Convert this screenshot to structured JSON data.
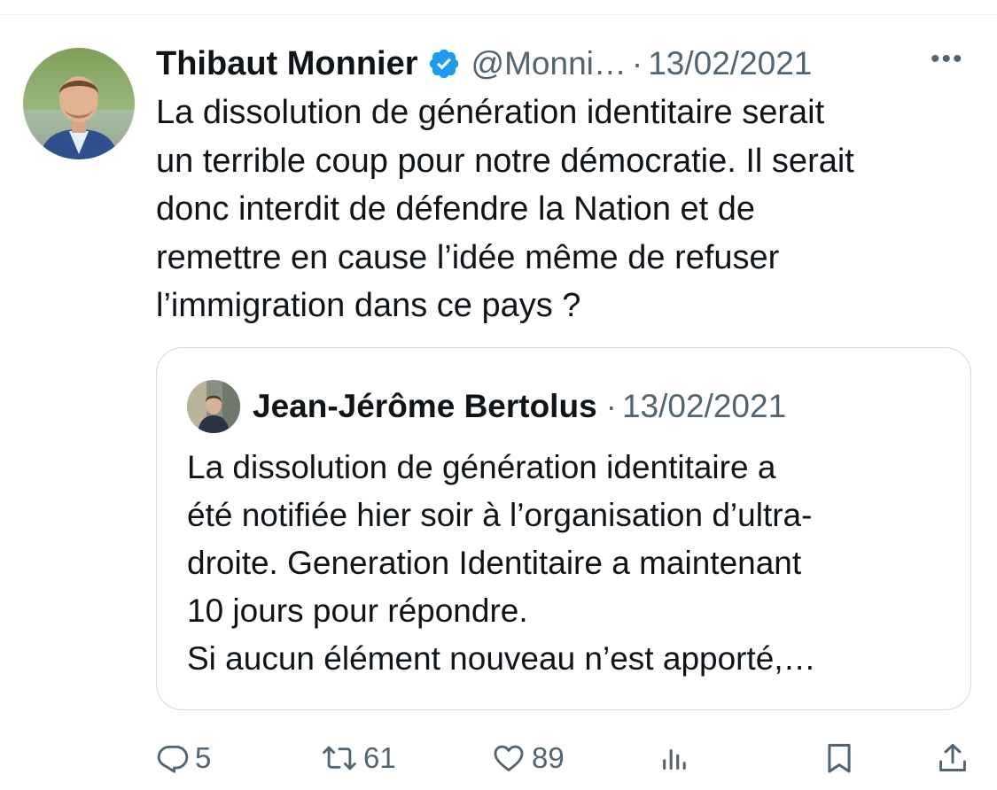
{
  "tweet": {
    "author_name": "Thibaut Monnier",
    "handle": "@Monni…",
    "separator": "·",
    "date": "13/02/2021",
    "more_label": "•••",
    "text_lines": [
      "La dissolution de génération identitaire serait",
      "un terrible coup pour notre démocratie. Il serait",
      "donc interdit de défendre la Nation et de",
      "remettre en cause l’idée même de refuser",
      "l’immigration dans ce pays ?"
    ]
  },
  "quote": {
    "author_name": "Jean-Jérôme Bertolus",
    "separator": "·",
    "date": "13/02/2021",
    "text_lines": [
      "La dissolution de génération identitaire a",
      "été notifiée hier soir à l’organisation d’ultra-",
      "droite. Generation Identitaire a maintenant",
      "10 jours pour répondre.",
      "Si aucun élément nouveau n’est apporté,…"
    ]
  },
  "actions": {
    "replies": "5",
    "retweets": "61",
    "likes": "89"
  },
  "icons": {
    "verified": "verified-badge-icon",
    "reply": "reply-icon",
    "retweet": "retweet-icon",
    "like": "heart-icon",
    "views": "views-icon",
    "bookmark": "bookmark-icon",
    "share": "share-icon"
  },
  "colors": {
    "text": "#0f1419",
    "secondary": "#536471",
    "verified": "#1d9bf0",
    "border": "#cfd9de"
  }
}
